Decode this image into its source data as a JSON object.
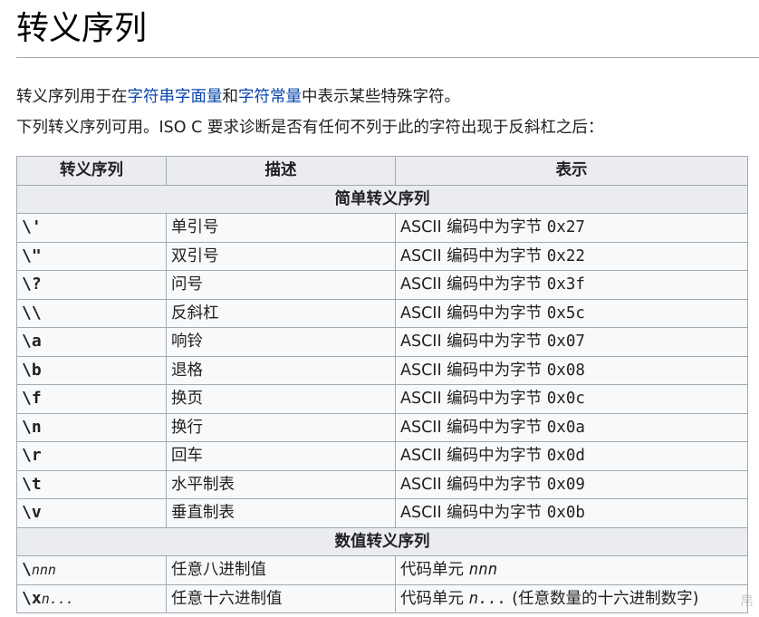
{
  "page": {
    "title": "转义序列"
  },
  "intro": {
    "line1_a": "转义序列用于在",
    "link1": "字符串字面量",
    "line1_b": "和",
    "link2": "字符常量",
    "line1_c": "中表示某些特殊字符。",
    "line2": "下列转义序列可用。ISO C 要求诊断是否有任何不列于此的字符出现于反斜杠之后："
  },
  "table": {
    "headers": [
      "转义序列",
      "描述",
      "表示"
    ],
    "section_simple": "简单转义序列",
    "simple_rows": [
      {
        "seq": "\\'",
        "desc": "单引号",
        "rep_prefix": "ASCII 编码中为字节 ",
        "rep_code": "0x27"
      },
      {
        "seq": "\\\"",
        "desc": "双引号",
        "rep_prefix": "ASCII 编码中为字节 ",
        "rep_code": "0x22"
      },
      {
        "seq": "\\?",
        "desc": "问号",
        "rep_prefix": "ASCII 编码中为字节 ",
        "rep_code": "0x3f"
      },
      {
        "seq": "\\\\",
        "desc": "反斜杠",
        "rep_prefix": "ASCII 编码中为字节 ",
        "rep_code": "0x5c"
      },
      {
        "seq": "\\a",
        "desc": "响铃",
        "rep_prefix": "ASCII 编码中为字节 ",
        "rep_code": "0x07"
      },
      {
        "seq": "\\b",
        "desc": "退格",
        "rep_prefix": "ASCII 编码中为字节 ",
        "rep_code": "0x08"
      },
      {
        "seq": "\\f",
        "desc": "换页",
        "rep_prefix": "ASCII 编码中为字节 ",
        "rep_code": "0x0c"
      },
      {
        "seq": "\\n",
        "desc": "换行",
        "rep_prefix": "ASCII 编码中为字节 ",
        "rep_code": "0x0a"
      },
      {
        "seq": "\\r",
        "desc": "回车",
        "rep_prefix": "ASCII 编码中为字节 ",
        "rep_code": "0x0d"
      },
      {
        "seq": "\\t",
        "desc": "水平制表",
        "rep_prefix": "ASCII 编码中为字节 ",
        "rep_code": "0x09"
      },
      {
        "seq": "\\v",
        "desc": "垂直制表",
        "rep_prefix": "ASCII 编码中为字节 ",
        "rep_code": "0x0b"
      }
    ],
    "section_numeric": "数值转义序列",
    "numeric_rows": [
      {
        "seq_bold": "\\",
        "seq_italic": "nnn",
        "desc": "任意八进制值",
        "rep_prefix": "代码单元 ",
        "rep_code": "nnn",
        "rep_suffix": ""
      },
      {
        "seq_bold": "\\x",
        "seq_italic": "n...",
        "desc": "任意十六进制值",
        "rep_prefix": "代码单元 ",
        "rep_code": "n...",
        "rep_suffix": " (任意数量的十六进制数字)"
      }
    ]
  },
  "watermark": "帛"
}
